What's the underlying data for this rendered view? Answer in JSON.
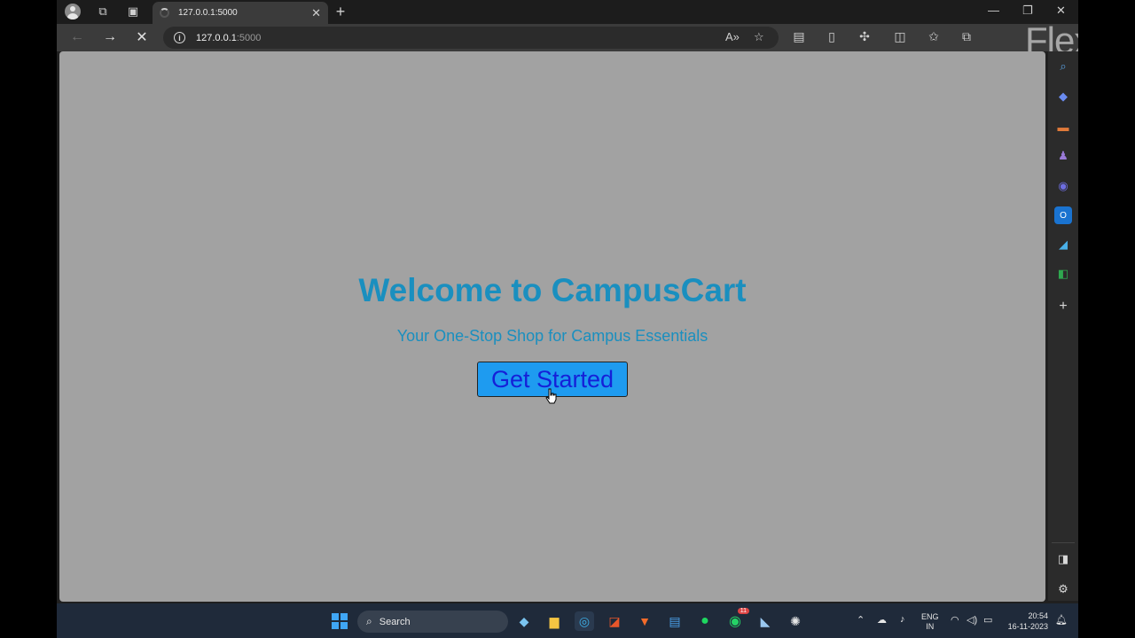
{
  "browser": {
    "tab": {
      "title": "127.0.0.1:5000"
    },
    "address": {
      "host": "127.0.0.1",
      "port": ":5000"
    }
  },
  "page": {
    "title": "Welcome to CampusCart",
    "subtitle": "Your One-Stop Shop for Campus Essentials",
    "cta_label": "Get Started"
  },
  "watermark": "FlexClip",
  "taskbar": {
    "search_label": "Search",
    "whatsapp_badge": "11",
    "language_top": "ENG",
    "language_bottom": "IN",
    "time": "20:54",
    "date": "16-11-2023"
  },
  "colors": {
    "heading": "#1a8fbf",
    "button_bg": "#1e9bf0",
    "button_text": "#1520d8",
    "page_bg": "#a2a2a2"
  }
}
